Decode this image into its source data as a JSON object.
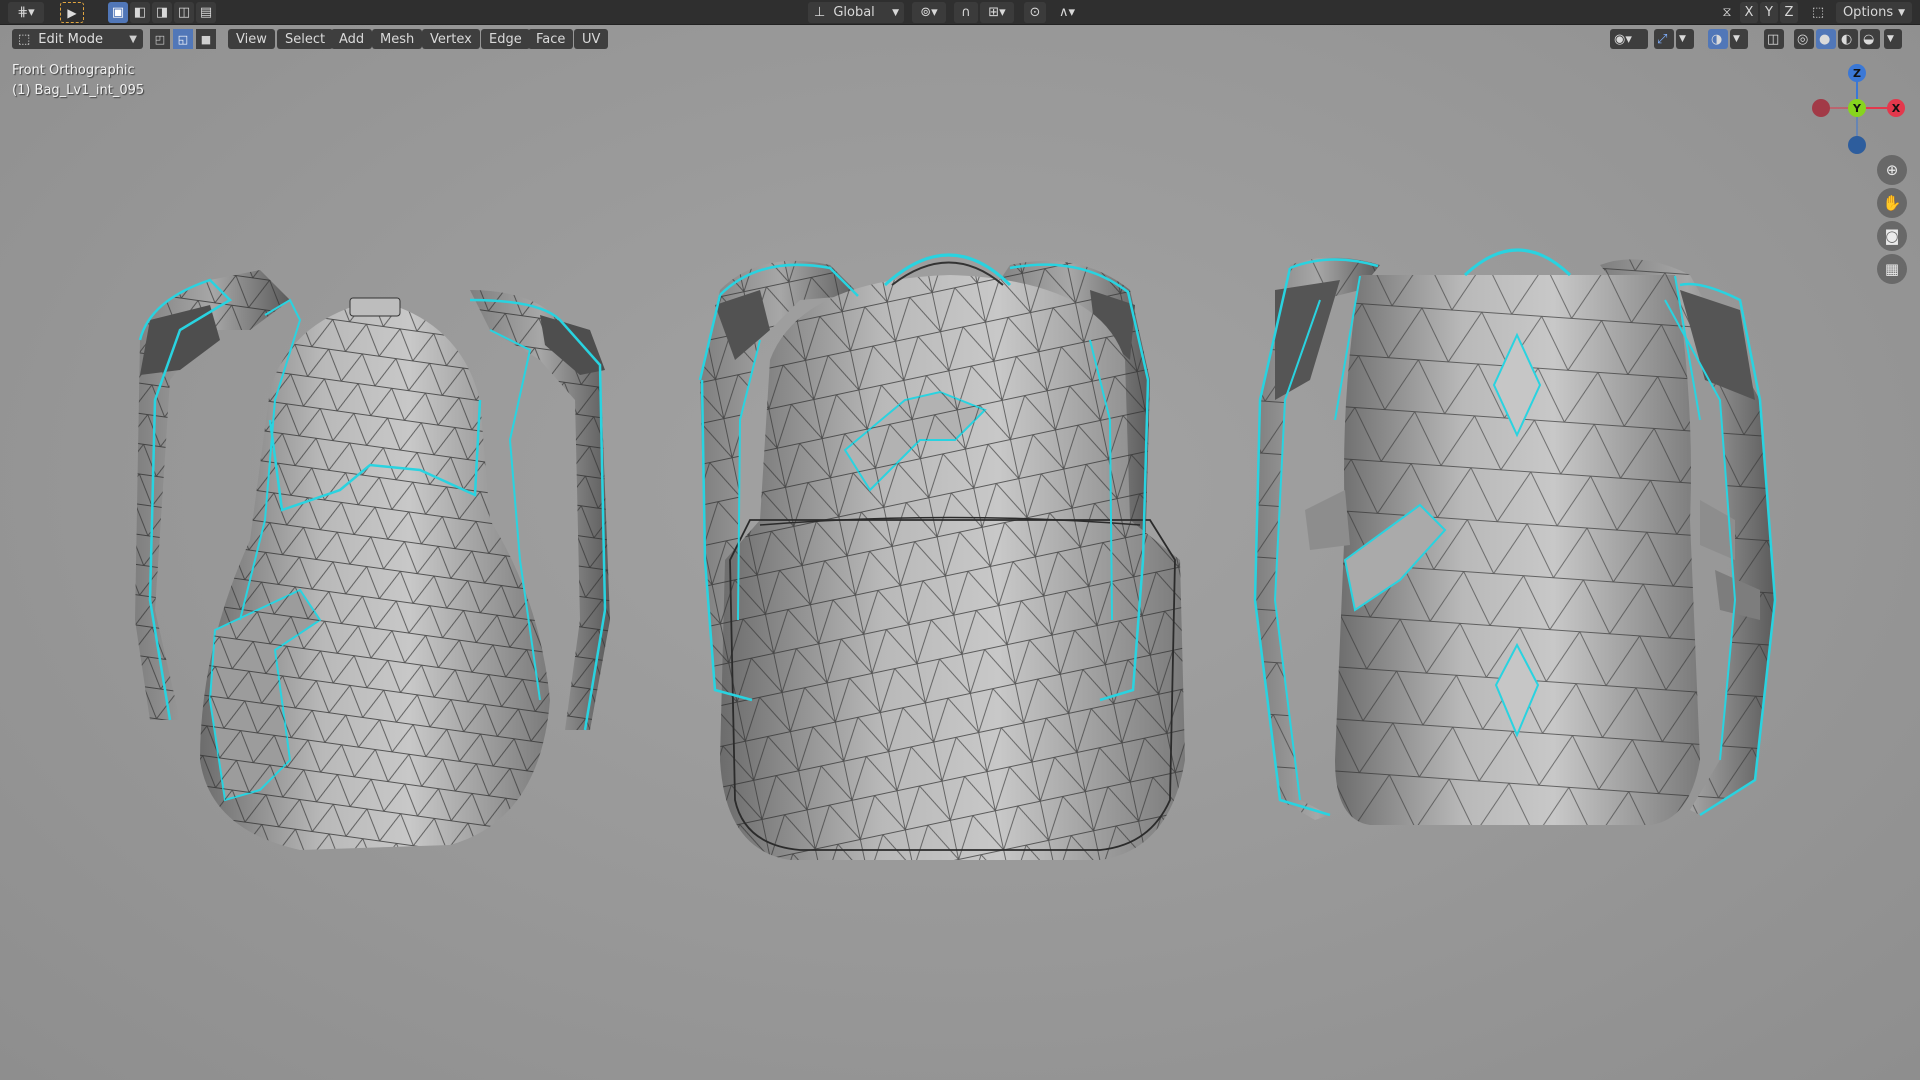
{
  "header": {
    "transform_orientation": "Global",
    "axis_x": "X",
    "axis_y": "Y",
    "axis_z": "Z",
    "options_label": "Options"
  },
  "view_header": {
    "mode": "Edit Mode",
    "menus": [
      "View",
      "Select",
      "Add",
      "Mesh",
      "Vertex",
      "Edge",
      "Face",
      "UV"
    ]
  },
  "overlay": {
    "view_name": "Front Orthographic",
    "object_name": "(1) Bag_Lv1_int_095"
  },
  "gizmo": {
    "x_label": "X",
    "y_label": "Y",
    "z_label": "Z"
  },
  "colors": {
    "accent": "#5177b8",
    "seam": "#29d3e0",
    "x_axis": "#e3384c",
    "y_axis": "#87d41e",
    "z_axis": "#3b78d6"
  }
}
